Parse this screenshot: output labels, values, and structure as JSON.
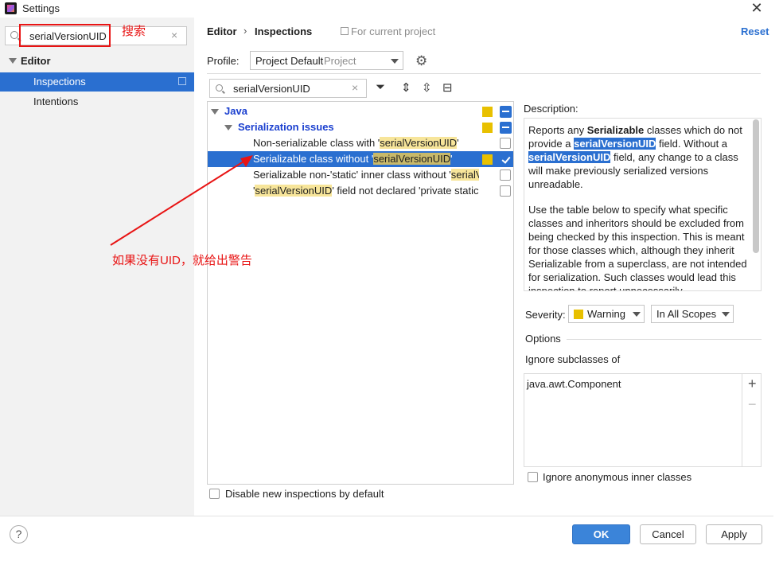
{
  "window": {
    "title": "Settings",
    "close_glyph": "✕"
  },
  "sidebar": {
    "search_value": "serialVersionUID",
    "clear_glyph": "×",
    "items": [
      {
        "label": "Editor"
      },
      {
        "label": "Inspections"
      },
      {
        "label": "Intentions"
      }
    ]
  },
  "annotations": {
    "search_note": "搜索",
    "uid_note": "如果没有UID，就给出警告",
    "color": "#e81414"
  },
  "header": {
    "breadcrumb": [
      "Editor",
      "Inspections"
    ],
    "breadcrumb_sep": "›",
    "scope_hint": "For current project",
    "reset": "Reset"
  },
  "profile": {
    "label": "Profile:",
    "value": "Project Default",
    "sub": "Project"
  },
  "filter": {
    "value": "serialVersionUID",
    "clear_glyph": "×"
  },
  "tree": {
    "root": "Java",
    "group": "Serialization issues",
    "items": [
      {
        "pre": "Non-serializable class with '",
        "hl": "serialVersionUID",
        "post": "'",
        "checked": false
      },
      {
        "pre": "Serializable class without '",
        "hl": "serialVersionUID",
        "post": "'",
        "checked": true
      },
      {
        "pre": "Serializable non-'static' inner class without '",
        "hl": "serialV",
        "post": "",
        "checked": false
      },
      {
        "pre": "'",
        "hl": "serialVersionUID",
        "post": "' field not declared 'private static",
        "checked": false
      }
    ]
  },
  "disable_new": "Disable new inspections by default",
  "description": {
    "label": "Description:",
    "p1": [
      "Reports any ",
      "Serializable",
      " classes which do not provide a ",
      "serialVersionUID",
      " field. Without a ",
      "serialVersionUID",
      " field, any change to a class will make previously serialized versions unreadable."
    ],
    "p2": "Use the table below to specify what specific classes and inheritors should be excluded from being checked by this inspection. This is meant for those classes which, although they inherit Serializable from a superclass, are not intended for serialization. Such classes would lead this inspection to report unnecessarily."
  },
  "severity": {
    "label": "Severity:",
    "value": "Warning",
    "scope": "In All Scopes",
    "color": "#e8c000"
  },
  "options": {
    "label": "Options",
    "ignore_label": "Ignore subclasses of",
    "list": [
      "java.awt.Component"
    ],
    "anon_label": "Ignore anonymous inner classes"
  },
  "footer": {
    "help": "?",
    "ok": "OK",
    "cancel": "Cancel",
    "apply": "Apply"
  },
  "colors": {
    "accent": "#2a6fd0",
    "highlight": "#f7e59a",
    "java_node": "#1a3fcf"
  }
}
